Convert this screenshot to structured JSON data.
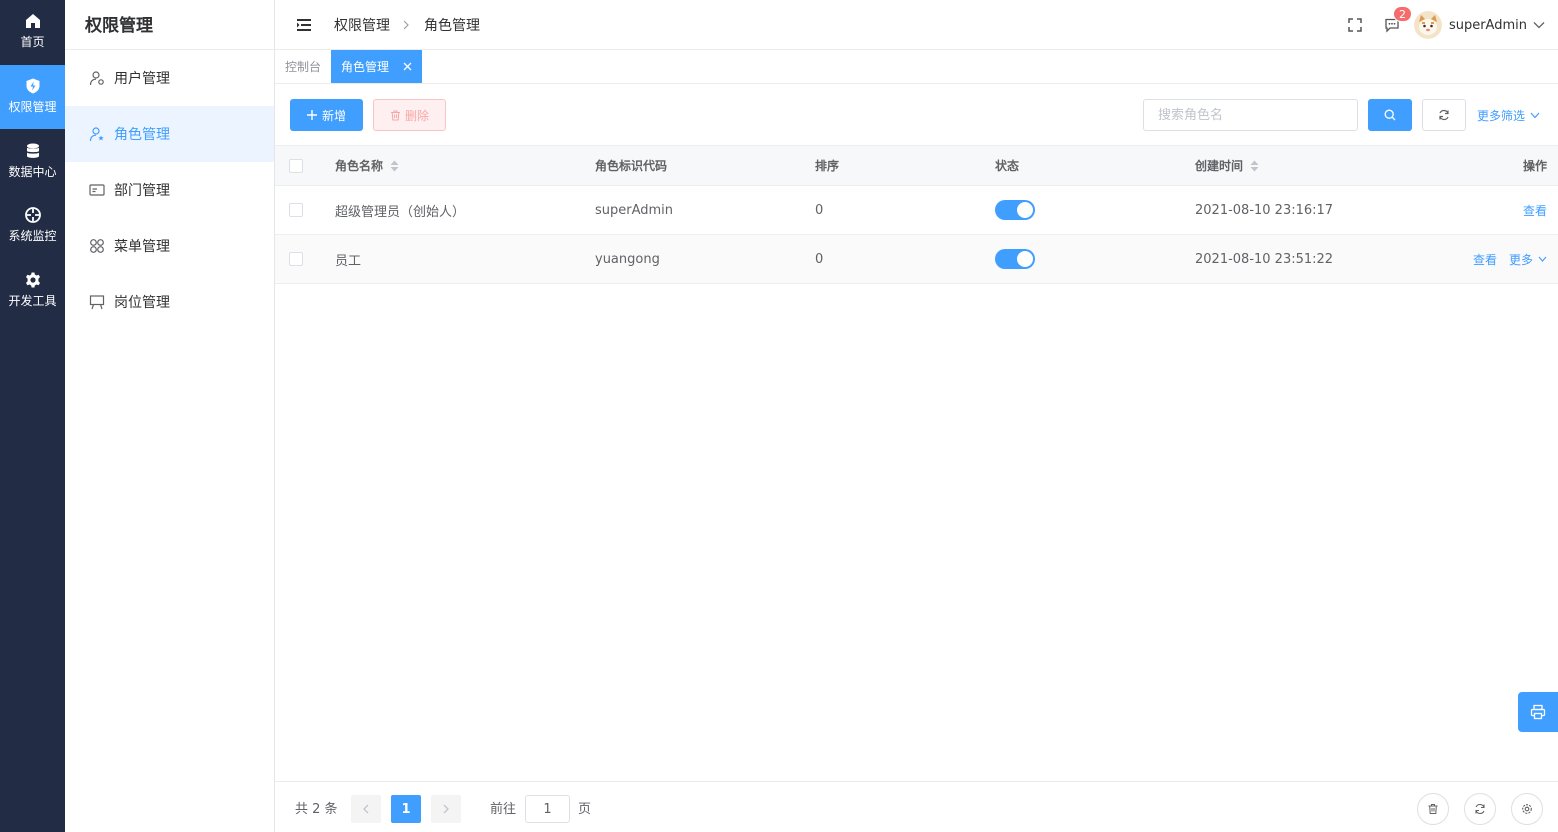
{
  "rail": {
    "items": [
      {
        "label": "首页",
        "icon": "home-icon",
        "active": false
      },
      {
        "label": "权限管理",
        "icon": "shield-icon",
        "active": true
      },
      {
        "label": "数据中心",
        "icon": "database-icon",
        "active": false
      },
      {
        "label": "系统监控",
        "icon": "crosshair-icon",
        "active": false
      },
      {
        "label": "开发工具",
        "icon": "gear-icon",
        "active": false
      }
    ]
  },
  "submenu": {
    "title": "权限管理",
    "items": [
      {
        "label": "用户管理",
        "icon": "user-settings-icon"
      },
      {
        "label": "角色管理",
        "icon": "user-star-icon",
        "active": true
      },
      {
        "label": "部门管理",
        "icon": "id-card-icon"
      },
      {
        "label": "菜单管理",
        "icon": "grid-icon"
      },
      {
        "label": "岗位管理",
        "icon": "easel-icon"
      }
    ]
  },
  "header": {
    "breadcrumb": [
      "权限管理",
      "角色管理"
    ],
    "badge_count": "2",
    "username": "superAdmin"
  },
  "tabs": [
    {
      "label": "控制台",
      "active": false
    },
    {
      "label": "角色管理",
      "active": true
    }
  ],
  "toolbar": {
    "add_label": "新增",
    "delete_label": "删除",
    "search_placeholder": "搜索角色名",
    "more_filter_label": "更多筛选"
  },
  "table": {
    "columns": [
      "角色名称",
      "角色标识代码",
      "排序",
      "状态",
      "创建时间",
      "操作"
    ],
    "rows": [
      {
        "name": "超级管理员（创始人）",
        "code": "superAdmin",
        "sort": "0",
        "status": true,
        "created": "2021-08-10 23:16:17",
        "actions": [
          "查看"
        ]
      },
      {
        "name": "员工",
        "code": "yuangong",
        "sort": "0",
        "status": true,
        "created": "2021-08-10 23:51:22",
        "actions": [
          "查看",
          "更多"
        ]
      }
    ]
  },
  "pagination": {
    "total_text": "共 2 条",
    "current_page": "1",
    "goto_label": "前往",
    "goto_value": "1",
    "goto_suffix": "页"
  },
  "colors": {
    "primary": "#409eff",
    "rail_bg": "#222d45",
    "danger": "#f56c6c"
  }
}
